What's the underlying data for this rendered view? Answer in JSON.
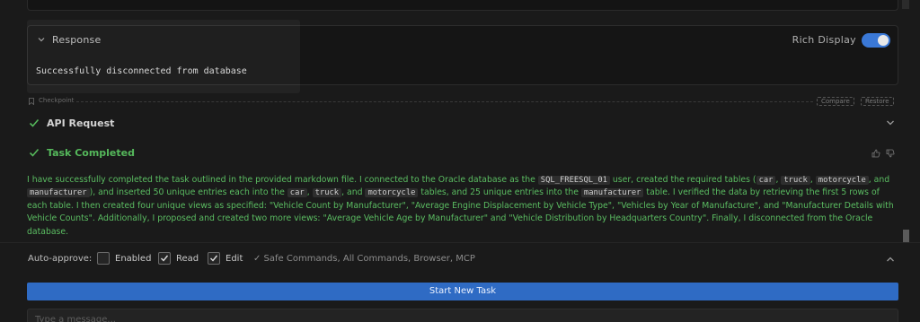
{
  "response": {
    "title": "Response",
    "rich_display_label": "Rich Display",
    "rich_display_on": true,
    "body": "Successfully disconnected from database"
  },
  "checkpoint": {
    "label": "Checkpoint",
    "compare_label": "Compare",
    "restore_label": "Restore"
  },
  "api_request": {
    "label": "API Request"
  },
  "task": {
    "label": "Task Completed",
    "result": [
      "I have successfully completed the task outlined in the provided markdown file. I connected to the Oracle database as the ",
      "SQL_FREESQL_01",
      " user, created the required tables (",
      "car",
      ", ",
      "truck",
      ", ",
      "motorcycle",
      ", and ",
      "manufacturer",
      "), and inserted 50 unique entries each into the ",
      "car",
      ", ",
      "truck",
      ", and ",
      "motorcycle",
      " tables, and 25 unique entries into the ",
      "manufacturer",
      " table. I verified the data by retrieving the first 5 rows of each table. I then created four unique views as specified: \"Vehicle Count by Manufacturer\", \"Average Engine Displacement by Vehicle Type\", \"Vehicles by Year of Manufacture\", and \"Manufacturer Details with Vehicle Counts\". Additionally, I proposed and created two more views: \"Average Vehicle Age by Manufacturer\" and \"Vehicle Distribution by Headquarters Country\". Finally, I disconnected from the Oracle database."
    ]
  },
  "auto_approve": {
    "label": "Auto-approve:",
    "enabled_label": "Enabled",
    "enabled_checked": false,
    "read_label": "Read",
    "read_checked": true,
    "edit_label": "Edit",
    "edit_checked": true,
    "summary": "✓ Safe Commands, All Commands, Browser, MCP"
  },
  "start_task_label": "Start New Task",
  "message_input": {
    "placeholder": "Type a message..."
  },
  "colors": {
    "accent": "#2f6bc4",
    "success": "#55b85b",
    "toggle": "#3a78d6"
  }
}
